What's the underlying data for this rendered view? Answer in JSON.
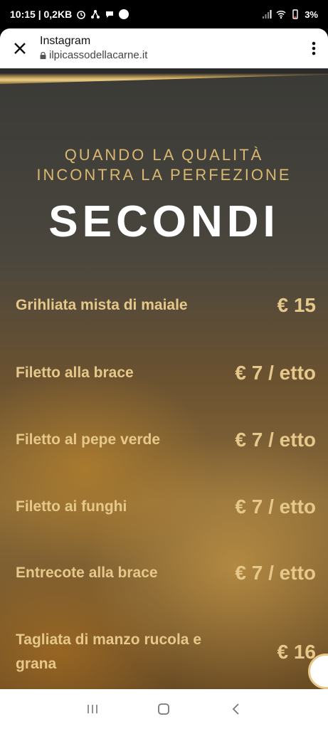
{
  "status_bar": {
    "time_data": "10:15 | 0,2KB",
    "battery": "3%"
  },
  "browser": {
    "title": "Instagram",
    "url": "ilpicassodellacarne.it"
  },
  "page": {
    "tagline_line1": "QUANDO LA QUALITÀ",
    "tagline_line2": "INCONTRA LA PERFEZIONE",
    "section_title": "SECONDI",
    "items": [
      {
        "name": "Grihliata mista di maiale",
        "price": "€ 15"
      },
      {
        "name": "Filetto alla brace",
        "price": "€ 7 / etto"
      },
      {
        "name": "Filetto al pepe verde",
        "price": "€ 7 / etto"
      },
      {
        "name": "Filetto ai funghi",
        "price": "€ 7 / etto"
      },
      {
        "name": "Entrecote alla brace",
        "price": "€ 7 / etto"
      },
      {
        "name": "Tagliata di manzo rucola e grana",
        "price": "€ 16"
      }
    ]
  },
  "icons": {
    "close": "close-icon",
    "menu": "more-vert-icon",
    "lock": "lock-icon",
    "recents": "recents-icon",
    "home": "home-icon",
    "back": "back-icon"
  },
  "colors": {
    "gold": "#d9b870",
    "item_text": "#e6c98a",
    "title": "#ffffff"
  }
}
